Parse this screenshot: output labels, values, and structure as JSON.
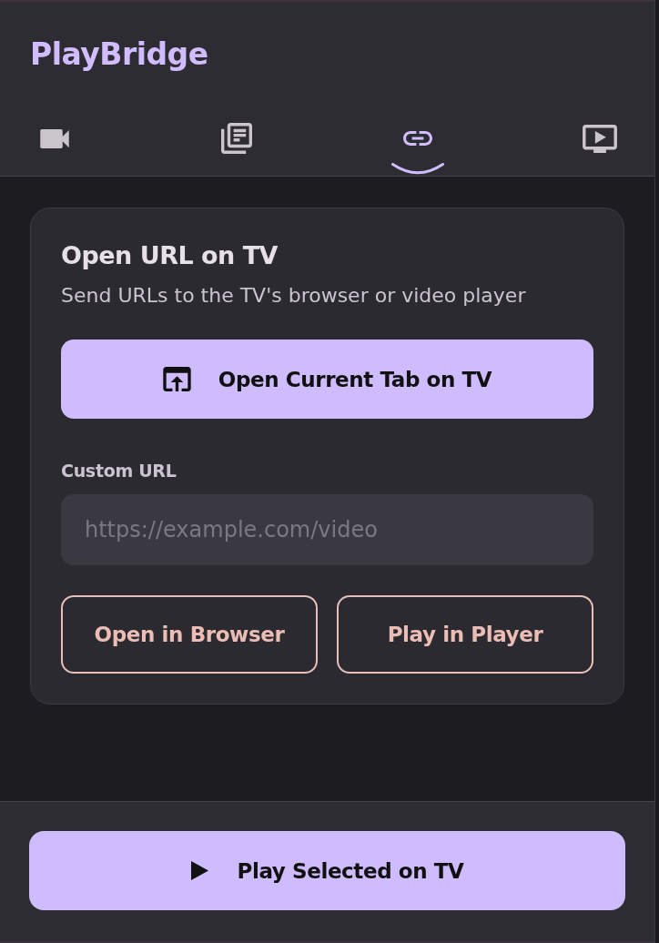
{
  "app": {
    "title": "PlayBridge"
  },
  "tabs": [
    {
      "selected": false
    },
    {
      "selected": false
    },
    {
      "selected": true
    },
    {
      "selected": false
    }
  ],
  "card": {
    "title": "Open URL on TV",
    "subtitle": "Send URLs to the TV's browser or video player",
    "primary_button": "Open Current Tab on TV",
    "custom_url": {
      "label": "Custom URL",
      "placeholder": "https://example.com/video"
    },
    "buttons": [
      "Open in Browser",
      "Play in Player"
    ]
  },
  "footer": {
    "button": "Play Selected on TV"
  }
}
